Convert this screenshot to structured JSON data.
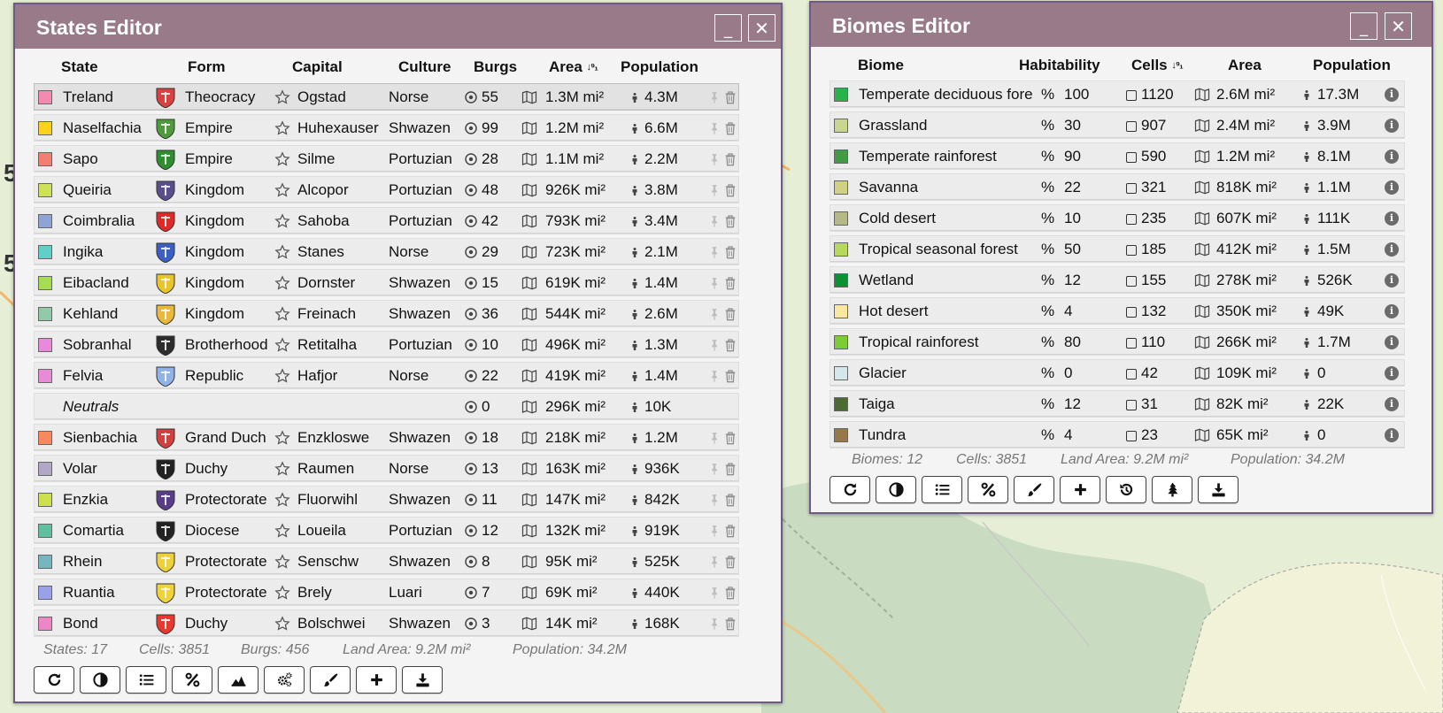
{
  "map": {
    "labels": [
      "5",
      "5"
    ]
  },
  "states_editor": {
    "title": "States Editor",
    "headers": {
      "state": "State",
      "form": "Form",
      "capital": "Capital",
      "culture": "Culture",
      "burgs": "Burgs",
      "area": "Area",
      "population": "Population"
    },
    "rows": [
      {
        "name": "Treland",
        "color": "#f38ab1",
        "form": "Theocracy",
        "capital": "Ogstad",
        "culture": "Norse",
        "burgs": "55",
        "area": "1.3M mi²",
        "population": "4.3M",
        "coa": "#d94040",
        "selected": true
      },
      {
        "name": "Naselfachia",
        "color": "#ffd21a",
        "form": "Empire",
        "capital": "Huhexauser",
        "culture": "Shwazen",
        "burgs": "99",
        "area": "1.2M mi²",
        "population": "6.6M",
        "coa": "#4f9a3c"
      },
      {
        "name": "Sapo",
        "color": "#f37f73",
        "form": "Empire",
        "capital": "Silme",
        "culture": "Portuzian",
        "burgs": "28",
        "area": "1.1M mi²",
        "population": "2.2M",
        "coa": "#2f8f2f"
      },
      {
        "name": "Queiria",
        "color": "#cfe05a",
        "form": "Kingdom",
        "capital": "Alcopor",
        "culture": "Portuzian",
        "burgs": "48",
        "area": "926K mi²",
        "population": "3.8M",
        "coa": "#5b4e8c"
      },
      {
        "name": "Coimbralia",
        "color": "#8ea3d6",
        "form": "Kingdom",
        "capital": "Sahoba",
        "culture": "Portuzian",
        "burgs": "42",
        "area": "793K mi²",
        "population": "3.4M",
        "coa": "#e02a2a"
      },
      {
        "name": "Ingika",
        "color": "#5fd0c8",
        "form": "Kingdom",
        "capital": "Stanes",
        "culture": "Norse",
        "burgs": "29",
        "area": "723K mi²",
        "population": "2.1M",
        "coa": "#3b5fc4"
      },
      {
        "name": "Eibacland",
        "color": "#a7dd52",
        "form": "Kingdom",
        "capital": "Dornster",
        "culture": "Shwazen",
        "burgs": "15",
        "area": "619K mi²",
        "population": "1.4M",
        "coa": "#e9c52a"
      },
      {
        "name": "Kehland",
        "color": "#92c9a6",
        "form": "Kingdom",
        "capital": "Freinach",
        "culture": "Shwazen",
        "burgs": "36",
        "area": "544K mi²",
        "population": "2.6M",
        "coa": "#e8b93a"
      },
      {
        "name": "Sobranhal",
        "color": "#e989d9",
        "form": "Brotherhood",
        "capital": "Retitalha",
        "culture": "Portuzian",
        "burgs": "10",
        "area": "496K mi²",
        "population": "1.3M",
        "coa": "#2c2c2c"
      },
      {
        "name": "Felvia",
        "color": "#e98ad6",
        "form": "Republic",
        "capital": "Hafjor",
        "culture": "Norse",
        "burgs": "22",
        "area": "419K mi²",
        "population": "1.4M",
        "coa": "#8fb3e8"
      },
      {
        "name": "Neutrals",
        "neutral": true,
        "burgs": "0",
        "area": "296K mi²",
        "population": "10K"
      },
      {
        "name": "Sienbachia",
        "color": "#f8895c",
        "form": "Grand Duch",
        "capital": "Enzkloswe",
        "culture": "Shwazen",
        "burgs": "18",
        "area": "218K mi²",
        "population": "1.2M",
        "coa": "#d33f3f"
      },
      {
        "name": "Volar",
        "color": "#b3a7c7",
        "form": "Duchy",
        "capital": "Raumen",
        "culture": "Norse",
        "burgs": "13",
        "area": "163K mi²",
        "population": "936K",
        "coa": "#222222"
      },
      {
        "name": "Enzkia",
        "color": "#cfe04f",
        "form": "Protectorate",
        "capital": "Fluorwihl",
        "culture": "Shwazen",
        "burgs": "11",
        "area": "147K mi²",
        "population": "842K",
        "coa": "#5a3d8a"
      },
      {
        "name": "Comartia",
        "color": "#5fbf9f",
        "form": "Diocese",
        "capital": "Loueila",
        "culture": "Portuzian",
        "burgs": "12",
        "area": "132K mi²",
        "population": "919K",
        "coa": "#222222"
      },
      {
        "name": "Rhein",
        "color": "#76b6bf",
        "form": "Protectorate",
        "capital": "Senschw",
        "culture": "Shwazen",
        "burgs": "8",
        "area": "95K mi²",
        "population": "525K",
        "coa": "#ecd13a"
      },
      {
        "name": "Ruantia",
        "color": "#98a1e9",
        "form": "Protectorate",
        "capital": "Brely",
        "culture": "Luari",
        "burgs": "7",
        "area": "69K mi²",
        "population": "440K",
        "coa": "#f0d33b"
      },
      {
        "name": "Bond",
        "color": "#ee85c6",
        "form": "Duchy",
        "capital": "Bolschwei",
        "culture": "Shwazen",
        "burgs": "3",
        "area": "14K mi²",
        "population": "168K",
        "coa": "#e8382f"
      }
    ],
    "footer": {
      "states": "States: 17",
      "cells": "Cells: 3851",
      "burgs": "Burgs: 456",
      "land_area": "Land Area: 9.2M mi²",
      "population": "Population: 34.2M"
    },
    "buttons": [
      "refresh-icon",
      "contrast-icon",
      "list-icon",
      "percent-icon",
      "chart-icon",
      "cogs-icon",
      "brush-icon",
      "plus-icon",
      "download-icon"
    ]
  },
  "biomes_editor": {
    "title": "Biomes Editor",
    "headers": {
      "biome": "Biome",
      "habitability": "Habitability",
      "cells": "Cells",
      "area": "Area",
      "population": "Population"
    },
    "rows": [
      {
        "name": "Temperate deciduous fore",
        "color": "#29b14c",
        "hab": "100",
        "cells": "1120",
        "area": "2.6M mi²",
        "population": "17.3M"
      },
      {
        "name": "Grassland",
        "color": "#c8d68f",
        "hab": "30",
        "cells": "907",
        "area": "2.4M mi²",
        "population": "3.9M"
      },
      {
        "name": "Temperate rainforest",
        "color": "#409c43",
        "hab": "90",
        "cells": "590",
        "area": "1.2M mi²",
        "population": "8.1M"
      },
      {
        "name": "Savanna",
        "color": "#d2d082",
        "hab": "22",
        "cells": "321",
        "area": "818K mi²",
        "population": "1.1M"
      },
      {
        "name": "Cold desert",
        "color": "#b5b887",
        "hab": "10",
        "cells": "235",
        "area": "607K mi²",
        "population": "111K"
      },
      {
        "name": "Tropical seasonal forest",
        "color": "#b6d95d",
        "hab": "50",
        "cells": "185",
        "area": "412K mi²",
        "population": "1.5M"
      },
      {
        "name": "Wetland",
        "color": "#0b9131",
        "hab": "12",
        "cells": "155",
        "area": "278K mi²",
        "population": "526K"
      },
      {
        "name": "Hot desert",
        "color": "#fbe79f",
        "hab": "4",
        "cells": "132",
        "area": "350K mi²",
        "population": "49K"
      },
      {
        "name": "Tropical rainforest",
        "color": "#7dcb35",
        "hab": "80",
        "cells": "110",
        "area": "266K mi²",
        "population": "1.7M"
      },
      {
        "name": "Glacier",
        "color": "#d5e7eb",
        "hab": "0",
        "cells": "42",
        "area": "109K mi²",
        "population": "0"
      },
      {
        "name": "Taiga",
        "color": "#4b6b32",
        "hab": "12",
        "cells": "31",
        "area": "82K mi²",
        "population": "22K"
      },
      {
        "name": "Tundra",
        "color": "#96784b",
        "hab": "4",
        "cells": "23",
        "area": "65K mi²",
        "population": "0"
      }
    ],
    "footer": {
      "biomes": "Biomes: 12",
      "cells": "Cells: 3851",
      "land_area": "Land Area: 9.2M mi²",
      "population": "Population: 34.2M"
    },
    "buttons": [
      "refresh-icon",
      "contrast-icon",
      "list-icon",
      "percent-icon",
      "brush-icon",
      "plus-icon",
      "history-icon",
      "tree-icon",
      "download-icon"
    ]
  },
  "glyphs": {
    "percent": "%",
    "star": "☆",
    "pin": "📌",
    "trash": "🗑",
    "minimize": "_",
    "close": "✕",
    "info": "i",
    "sort": "↓⁹₁"
  },
  "colors": {
    "titlebar": "#997a89",
    "border": "#6e5a88"
  }
}
